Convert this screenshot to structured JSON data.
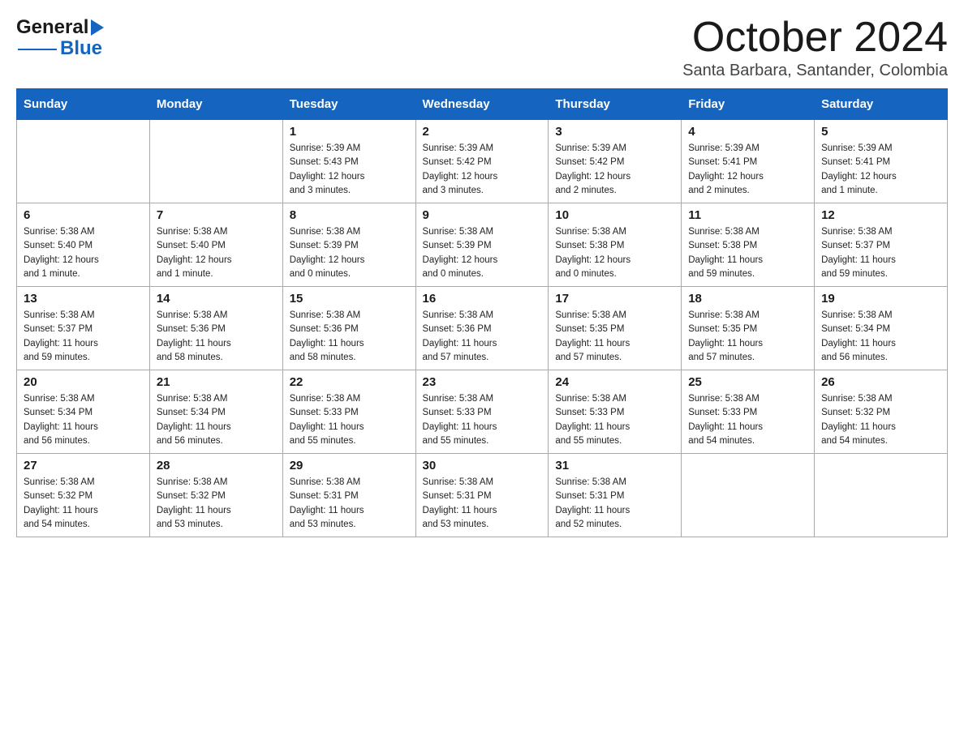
{
  "header": {
    "month_title": "October 2024",
    "location": "Santa Barbara, Santander, Colombia",
    "logo_general": "General",
    "logo_blue": "Blue"
  },
  "weekdays": [
    "Sunday",
    "Monday",
    "Tuesday",
    "Wednesday",
    "Thursday",
    "Friday",
    "Saturday"
  ],
  "weeks": [
    [
      {
        "day": "",
        "info": ""
      },
      {
        "day": "",
        "info": ""
      },
      {
        "day": "1",
        "info": "Sunrise: 5:39 AM\nSunset: 5:43 PM\nDaylight: 12 hours\nand 3 minutes."
      },
      {
        "day": "2",
        "info": "Sunrise: 5:39 AM\nSunset: 5:42 PM\nDaylight: 12 hours\nand 3 minutes."
      },
      {
        "day": "3",
        "info": "Sunrise: 5:39 AM\nSunset: 5:42 PM\nDaylight: 12 hours\nand 2 minutes."
      },
      {
        "day": "4",
        "info": "Sunrise: 5:39 AM\nSunset: 5:41 PM\nDaylight: 12 hours\nand 2 minutes."
      },
      {
        "day": "5",
        "info": "Sunrise: 5:39 AM\nSunset: 5:41 PM\nDaylight: 12 hours\nand 1 minute."
      }
    ],
    [
      {
        "day": "6",
        "info": "Sunrise: 5:38 AM\nSunset: 5:40 PM\nDaylight: 12 hours\nand 1 minute."
      },
      {
        "day": "7",
        "info": "Sunrise: 5:38 AM\nSunset: 5:40 PM\nDaylight: 12 hours\nand 1 minute."
      },
      {
        "day": "8",
        "info": "Sunrise: 5:38 AM\nSunset: 5:39 PM\nDaylight: 12 hours\nand 0 minutes."
      },
      {
        "day": "9",
        "info": "Sunrise: 5:38 AM\nSunset: 5:39 PM\nDaylight: 12 hours\nand 0 minutes."
      },
      {
        "day": "10",
        "info": "Sunrise: 5:38 AM\nSunset: 5:38 PM\nDaylight: 12 hours\nand 0 minutes."
      },
      {
        "day": "11",
        "info": "Sunrise: 5:38 AM\nSunset: 5:38 PM\nDaylight: 11 hours\nand 59 minutes."
      },
      {
        "day": "12",
        "info": "Sunrise: 5:38 AM\nSunset: 5:37 PM\nDaylight: 11 hours\nand 59 minutes."
      }
    ],
    [
      {
        "day": "13",
        "info": "Sunrise: 5:38 AM\nSunset: 5:37 PM\nDaylight: 11 hours\nand 59 minutes."
      },
      {
        "day": "14",
        "info": "Sunrise: 5:38 AM\nSunset: 5:36 PM\nDaylight: 11 hours\nand 58 minutes."
      },
      {
        "day": "15",
        "info": "Sunrise: 5:38 AM\nSunset: 5:36 PM\nDaylight: 11 hours\nand 58 minutes."
      },
      {
        "day": "16",
        "info": "Sunrise: 5:38 AM\nSunset: 5:36 PM\nDaylight: 11 hours\nand 57 minutes."
      },
      {
        "day": "17",
        "info": "Sunrise: 5:38 AM\nSunset: 5:35 PM\nDaylight: 11 hours\nand 57 minutes."
      },
      {
        "day": "18",
        "info": "Sunrise: 5:38 AM\nSunset: 5:35 PM\nDaylight: 11 hours\nand 57 minutes."
      },
      {
        "day": "19",
        "info": "Sunrise: 5:38 AM\nSunset: 5:34 PM\nDaylight: 11 hours\nand 56 minutes."
      }
    ],
    [
      {
        "day": "20",
        "info": "Sunrise: 5:38 AM\nSunset: 5:34 PM\nDaylight: 11 hours\nand 56 minutes."
      },
      {
        "day": "21",
        "info": "Sunrise: 5:38 AM\nSunset: 5:34 PM\nDaylight: 11 hours\nand 56 minutes."
      },
      {
        "day": "22",
        "info": "Sunrise: 5:38 AM\nSunset: 5:33 PM\nDaylight: 11 hours\nand 55 minutes."
      },
      {
        "day": "23",
        "info": "Sunrise: 5:38 AM\nSunset: 5:33 PM\nDaylight: 11 hours\nand 55 minutes."
      },
      {
        "day": "24",
        "info": "Sunrise: 5:38 AM\nSunset: 5:33 PM\nDaylight: 11 hours\nand 55 minutes."
      },
      {
        "day": "25",
        "info": "Sunrise: 5:38 AM\nSunset: 5:33 PM\nDaylight: 11 hours\nand 54 minutes."
      },
      {
        "day": "26",
        "info": "Sunrise: 5:38 AM\nSunset: 5:32 PM\nDaylight: 11 hours\nand 54 minutes."
      }
    ],
    [
      {
        "day": "27",
        "info": "Sunrise: 5:38 AM\nSunset: 5:32 PM\nDaylight: 11 hours\nand 54 minutes."
      },
      {
        "day": "28",
        "info": "Sunrise: 5:38 AM\nSunset: 5:32 PM\nDaylight: 11 hours\nand 53 minutes."
      },
      {
        "day": "29",
        "info": "Sunrise: 5:38 AM\nSunset: 5:31 PM\nDaylight: 11 hours\nand 53 minutes."
      },
      {
        "day": "30",
        "info": "Sunrise: 5:38 AM\nSunset: 5:31 PM\nDaylight: 11 hours\nand 53 minutes."
      },
      {
        "day": "31",
        "info": "Sunrise: 5:38 AM\nSunset: 5:31 PM\nDaylight: 11 hours\nand 52 minutes."
      },
      {
        "day": "",
        "info": ""
      },
      {
        "day": "",
        "info": ""
      }
    ]
  ]
}
